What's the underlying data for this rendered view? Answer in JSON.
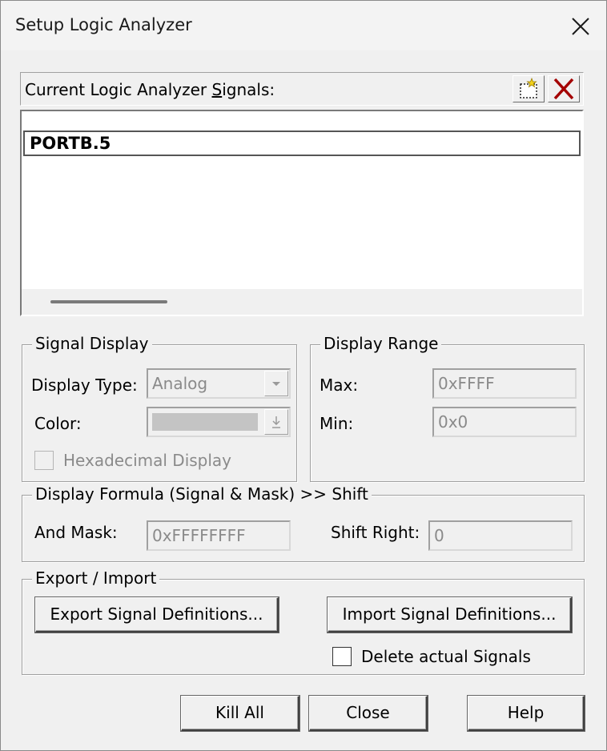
{
  "window": {
    "title": "Setup Logic Analyzer"
  },
  "signals": {
    "label_pre": "Current Logic Analyzer ",
    "label_hot": "S",
    "label_post": "ignals:",
    "items": [
      "PORTB.5"
    ],
    "new_icon": "new-signal-icon",
    "delete_icon": "delete-signal-icon"
  },
  "signal_display": {
    "title": "Signal Display",
    "display_type_label": "Display Type:",
    "display_type_value": "Analog",
    "color_label": "Color:",
    "color_value": "#c4c4c4",
    "hex_label": "Hexadecimal Display"
  },
  "display_range": {
    "title": "Display Range",
    "max_label": "Max:",
    "max_value": "0xFFFF",
    "min_label": "Min:",
    "min_value": "0x0"
  },
  "formula": {
    "title": "Display Formula (Signal & Mask) >> Shift",
    "and_mask_label": "And Mask:",
    "and_mask_value": "0xFFFFFFFF",
    "shift_right_label": "Shift Right:",
    "shift_right_value": "0"
  },
  "export_import": {
    "title": "Export / Import",
    "export_label": "Export Signal Definitions...",
    "import_label": "Import Signal Definitions...",
    "delete_label": "Delete actual Signals"
  },
  "footer": {
    "kill_all": "Kill All",
    "close": "Close",
    "help": "Help"
  }
}
